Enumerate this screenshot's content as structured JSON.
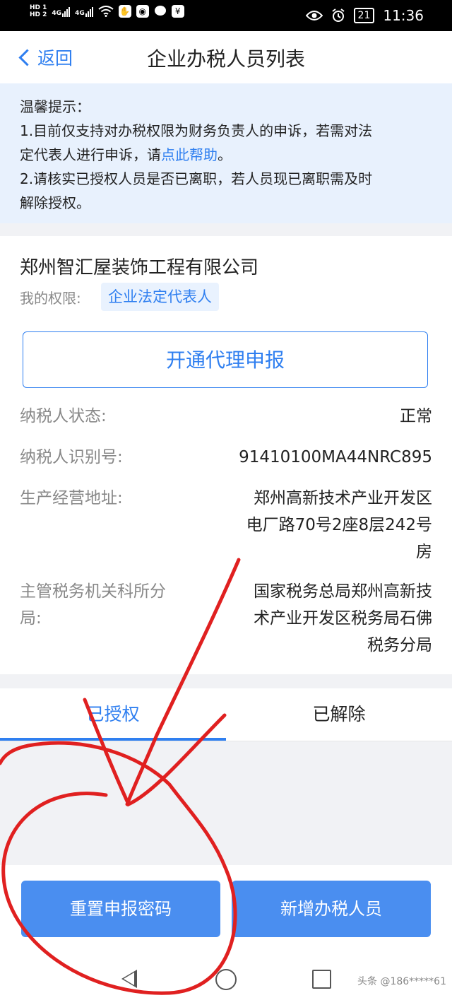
{
  "status_bar": {
    "hd1": "HD 1",
    "hd2": "HD 2",
    "net1": "4G",
    "net2": "4G",
    "battery": "21",
    "time": "11:36"
  },
  "nav": {
    "back_label": "返回",
    "title": "企业办税人员列表"
  },
  "notice": {
    "heading": "温馨提示：",
    "line1": "1.目前仅支持对办税权限为财务负责人的申诉，若需对法",
    "line2_prefix": "定代表人进行申诉，请",
    "line2_link": "点此帮助",
    "line2_suffix": "。",
    "line3": "2.请核实已授权人员是否已离职，若人员现已离职需及时",
    "line4": "解除授权。"
  },
  "company": {
    "name": "郑州智汇屋装饰工程有限公司",
    "permission_label": "我的权限:",
    "permission_value": "企业法定代表人",
    "agent_button": "开通代理申报",
    "fields": [
      {
        "label": "纳税人状态:",
        "value": "正常"
      },
      {
        "label": "纳税人识别号:",
        "value": "91410100MA44NRC895"
      },
      {
        "label": "生产经营地址:",
        "value_lines": [
          "郑州高新技术产业开发区",
          "电厂路70号2座8层242号",
          "房"
        ]
      },
      {
        "label_lines": [
          "主管税务机关科所分",
          "局:"
        ],
        "value_lines": [
          "国家税务总局郑州高新技",
          "术产业开发区税务局石佛",
          "税务分局"
        ]
      }
    ]
  },
  "tabs": [
    {
      "label": "已授权",
      "active": true
    },
    {
      "label": "已解除",
      "active": false
    }
  ],
  "bottom": {
    "reset_button": "重置申报密码",
    "add_button": "新增办税人员"
  },
  "watermark": "头条 @186*****61",
  "colors": {
    "accent": "#2f7ff0",
    "button_fill": "#4a8ef0",
    "notice_bg": "#e8f1fd",
    "annotation": "#e02020"
  },
  "icons": [
    "wifi-icon",
    "hand-icon",
    "app-icon",
    "chat-icon",
    "alipay-icon",
    "eye-icon",
    "alarm-icon",
    "battery-icon",
    "nav-back-icon",
    "nav-home-icon",
    "nav-recent-icon"
  ]
}
